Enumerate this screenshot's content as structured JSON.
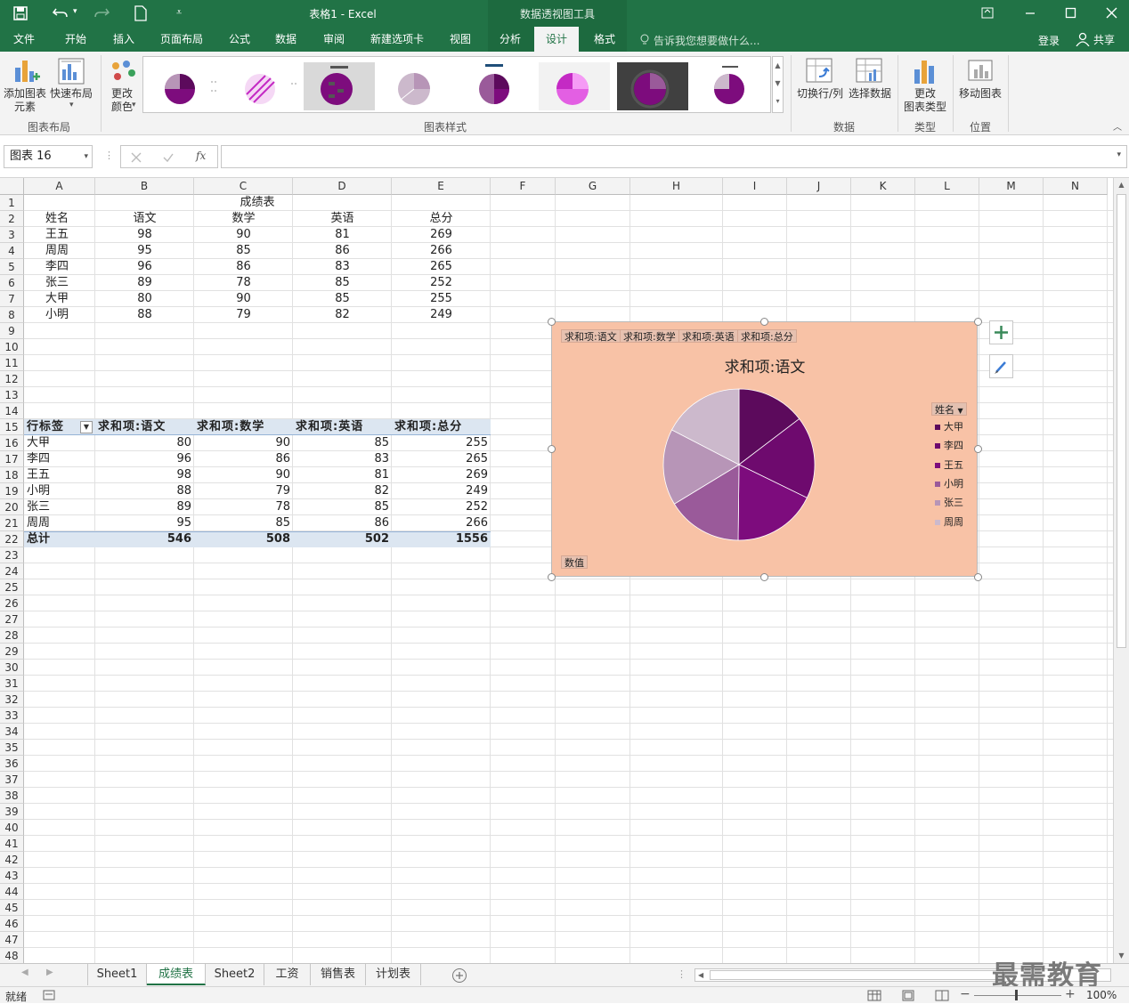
{
  "titlebar": {
    "title": "表格1 - Excel",
    "context_title": "数据透视图工具",
    "icons": [
      "save-icon",
      "undo-icon",
      "redo-icon",
      "new-doc-icon",
      "customize-icon",
      "ribbon-display-icon",
      "minimize-icon",
      "maximize-icon",
      "close-icon"
    ]
  },
  "tabs": [
    "文件",
    "开始",
    "插入",
    "页面布局",
    "公式",
    "数据",
    "审阅",
    "新建选项卡",
    "视图",
    "分析",
    "设计",
    "格式"
  ],
  "active_tab": "设计",
  "tell_me": "告诉我您想要做什么...",
  "signin": "登录",
  "share": "共享",
  "ribbon": {
    "add_element": "添加图表",
    "add_element_2": "元素",
    "quick_layout": "快速布局",
    "change_color": "更改",
    "change_color_2": "颜色",
    "group_layout": "图表布局",
    "group_styles": "图表样式",
    "switch_row_col": "切换行/列",
    "select_data": "选择数据",
    "group_data": "数据",
    "change_type": "更改",
    "change_type_2": "图表类型",
    "group_type": "类型",
    "move_chart": "移动图表",
    "group_location": "位置"
  },
  "formula_bar": {
    "name_box": "图表 16",
    "fx": "fx",
    "value": ""
  },
  "columns": [
    "A",
    "B",
    "C",
    "D",
    "E",
    "F",
    "G",
    "H",
    "I",
    "J",
    "K",
    "L",
    "M",
    "N"
  ],
  "sheet": {
    "title": "成绩表",
    "headers": [
      "姓名",
      "语文",
      "数学",
      "英语",
      "总分"
    ],
    "rows": [
      [
        "王五",
        "98",
        "90",
        "81",
        "269"
      ],
      [
        "周周",
        "95",
        "85",
        "86",
        "266"
      ],
      [
        "李四",
        "96",
        "86",
        "83",
        "265"
      ],
      [
        "张三",
        "89",
        "78",
        "85",
        "252"
      ],
      [
        "大甲",
        "80",
        "90",
        "85",
        "255"
      ],
      [
        "小明",
        "88",
        "79",
        "82",
        "249"
      ]
    ]
  },
  "pivot": {
    "headers": [
      "行标签",
      "求和项:语文",
      "求和项:数学",
      "求和项:英语",
      "求和项:总分"
    ],
    "rows": [
      [
        "大甲",
        "80",
        "90",
        "85",
        "255"
      ],
      [
        "李四",
        "96",
        "86",
        "83",
        "265"
      ],
      [
        "王五",
        "98",
        "90",
        "81",
        "269"
      ],
      [
        "小明",
        "88",
        "79",
        "82",
        "249"
      ],
      [
        "张三",
        "89",
        "78",
        "85",
        "252"
      ],
      [
        "周周",
        "95",
        "85",
        "86",
        "266"
      ]
    ],
    "total": [
      "总计",
      "546",
      "508",
      "502",
      "1556"
    ]
  },
  "chart": {
    "field_buttons": [
      "求和项:语文",
      "求和项:数学",
      "求和项:英语",
      "求和项:总分"
    ],
    "values_button": "数值",
    "legend_filter": "姓名",
    "bg_color": "#f8c2a6"
  },
  "chart_data": {
    "type": "pie",
    "title": "求和项:语文",
    "categories": [
      "大甲",
      "李四",
      "王五",
      "小明",
      "张三",
      "周周"
    ],
    "values": [
      80,
      96,
      98,
      88,
      89,
      95
    ],
    "colors": [
      "#5c0a5c",
      "#6e0a6e",
      "#7d0c7d",
      "#9a5a9a",
      "#b795b7",
      "#ccb9cc"
    ],
    "legend_position": "right"
  },
  "sheet_tabs": [
    "Sheet1",
    "成绩表",
    "Sheet2",
    "工资",
    "销售表",
    "计划表"
  ],
  "active_sheet": "成绩表",
  "status": {
    "ready": "就绪",
    "zoom": "100%"
  },
  "watermark": "最需教育"
}
